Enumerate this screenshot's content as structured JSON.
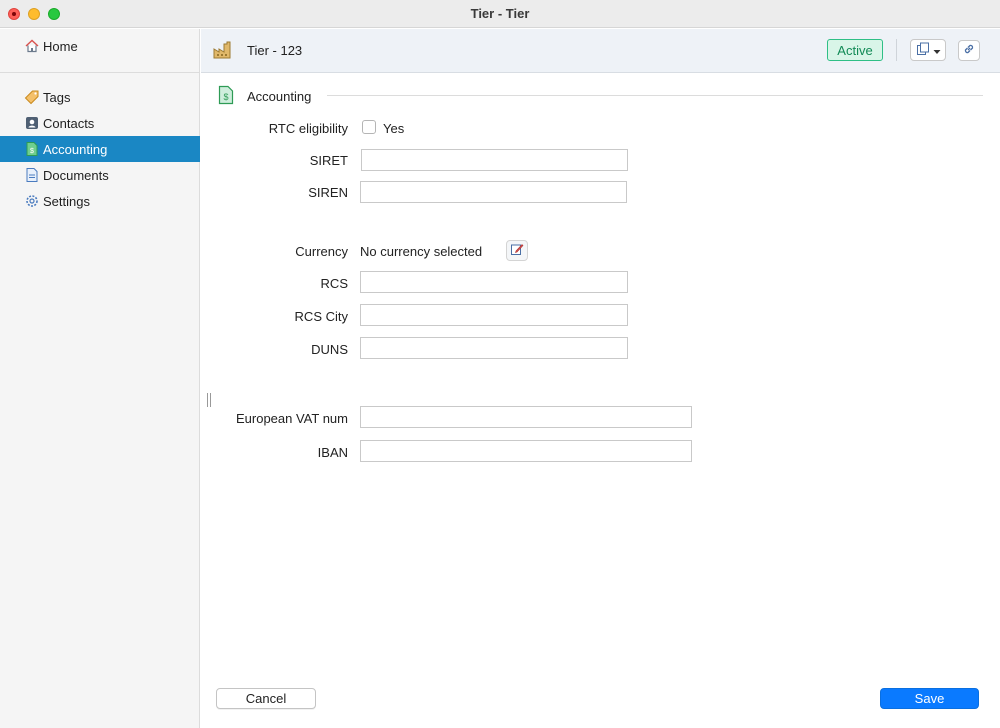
{
  "window": {
    "title": "Tier - Tier"
  },
  "sidebar": {
    "home": {
      "label": "Home",
      "icon": "home-icon"
    },
    "items": [
      {
        "label": "Tags",
        "icon": "tag-icon",
        "active": false
      },
      {
        "label": "Contacts",
        "icon": "contact-card-icon",
        "active": false
      },
      {
        "label": "Accounting",
        "icon": "accounting-document-icon",
        "active": true
      },
      {
        "label": "Documents",
        "icon": "document-icon",
        "active": false
      },
      {
        "label": "Settings",
        "icon": "gear-icon",
        "active": false
      }
    ]
  },
  "header": {
    "title": "Tier - 123",
    "icon": "factory-icon",
    "status": "Active",
    "status_color": "#128a56"
  },
  "section": {
    "title": "Accounting",
    "icon": "accounting-document-icon"
  },
  "form": {
    "rtc": {
      "label": "RTC eligibility",
      "checkbox_label": "Yes",
      "checked": false
    },
    "siret": {
      "label": "SIRET",
      "value": ""
    },
    "siren": {
      "label": "SIREN",
      "value": ""
    },
    "currency": {
      "label": "Currency",
      "value": "No currency selected"
    },
    "rcs": {
      "label": "RCS",
      "value": ""
    },
    "rcs_city": {
      "label": "RCS City",
      "value": ""
    },
    "duns": {
      "label": "DUNS",
      "value": ""
    },
    "vat": {
      "label": "European VAT num",
      "value": ""
    },
    "iban": {
      "label": "IBAN",
      "value": ""
    }
  },
  "footer": {
    "cancel_label": "Cancel",
    "save_label": "Save"
  },
  "colors": {
    "accent": "#1a87c4",
    "save": "#0a7aff",
    "active_badge_bg": "#d9f5e8"
  }
}
